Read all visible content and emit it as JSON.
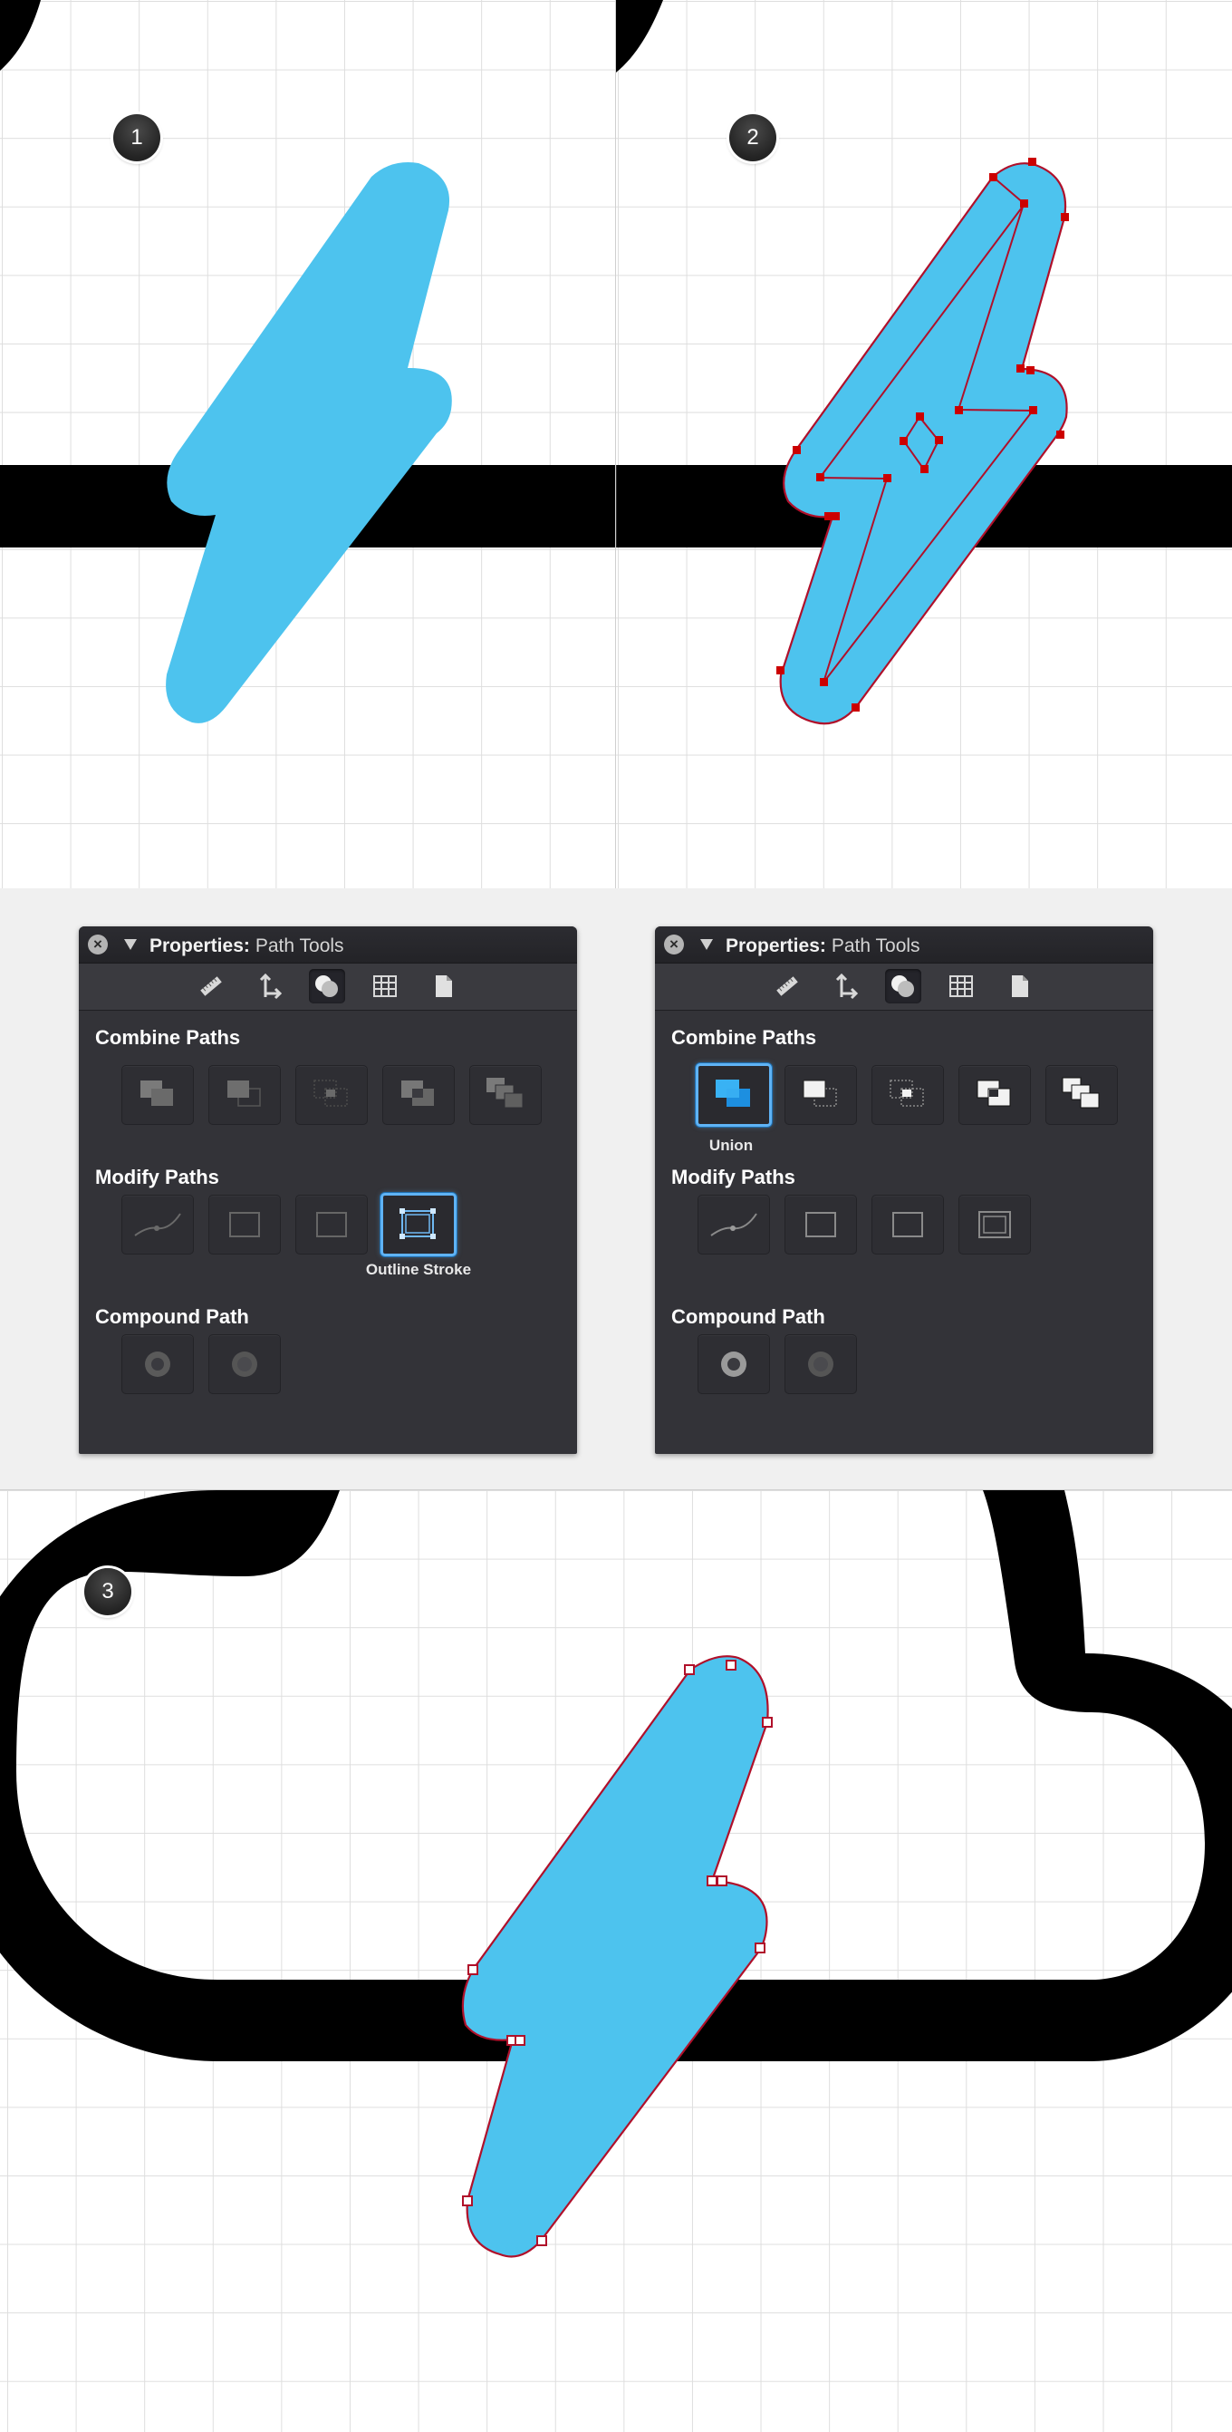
{
  "steps": {
    "step1": "1",
    "step2": "2",
    "step3": "3"
  },
  "panel_left": {
    "title_bold": "Properties:",
    "title_rest": "Path Tools",
    "combine_label": "Combine Paths",
    "modify_label": "Modify Paths",
    "compound_label": "Compound Path",
    "active_caption": "Outline Stroke"
  },
  "panel_right": {
    "title_bold": "Properties:",
    "title_rest": "Path Tools",
    "combine_label": "Combine Paths",
    "modify_label": "Modify Paths",
    "compound_label": "Compound Path",
    "active_caption": "Union"
  },
  "tabs": [
    "ruler-icon",
    "transform-icon",
    "path-tools-icon",
    "grid-icon",
    "document-icon"
  ],
  "colors": {
    "bolt_fill": "#4dc3ee",
    "anchor_point": "#cc0000",
    "path_outline": "#b0102a",
    "selection_blue": "#5fb3f5",
    "panel_bg": "#333338"
  }
}
